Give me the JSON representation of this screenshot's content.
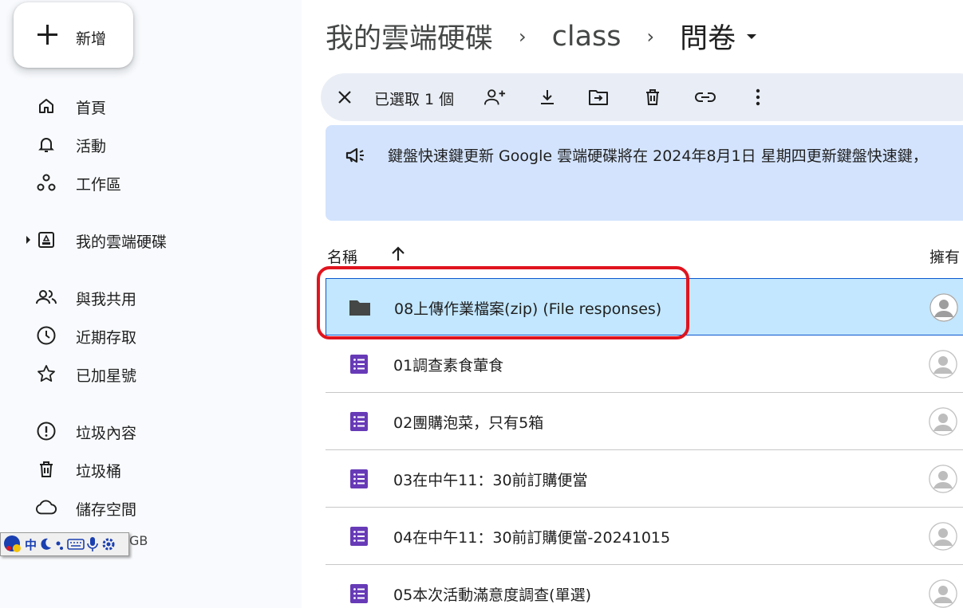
{
  "sidebar": {
    "new_label": "新增",
    "items": [
      {
        "label": "首頁",
        "icon": "home-icon"
      },
      {
        "label": "活動",
        "icon": "bell-icon"
      },
      {
        "label": "工作區",
        "icon": "workspaces-icon"
      },
      {
        "label": "我的雲端硬碟",
        "icon": "drive-icon"
      },
      {
        "label": "與我共用",
        "icon": "people-icon"
      },
      {
        "label": "近期存取",
        "icon": "clock-icon"
      },
      {
        "label": "已加星號",
        "icon": "star-icon"
      },
      {
        "label": "垃圾內容",
        "icon": "spam-icon"
      },
      {
        "label": "垃圾桶",
        "icon": "trash-icon"
      },
      {
        "label": "儲存空間",
        "icon": "cloud-icon"
      }
    ],
    "storage_fragment": "GB"
  },
  "ime": {
    "mode": "中",
    "icons": [
      "ime-logo-icon",
      "moon-icon",
      "punctuation-icon",
      "keyboard-icon",
      "mic-icon",
      "settings-icon"
    ]
  },
  "breadcrumb": {
    "items": [
      "我的雲端硬碟",
      "class",
      "問卷"
    ],
    "separator": "›"
  },
  "selection_bar": {
    "count_label": "已選取 1 個",
    "tools": [
      "share-icon",
      "download-icon",
      "move-icon",
      "trash-icon",
      "link-icon",
      "more-icon"
    ]
  },
  "banner": {
    "text": "鍵盤快速鍵更新 Google 雲端硬碟將在 2024年8月1日 星期四更新鍵盤快速鍵，"
  },
  "columns": {
    "name": "名稱",
    "owner": "擁有"
  },
  "files": [
    {
      "name": "08上傳作業檔案(zip) (File responses)",
      "type": "folder",
      "selected": true
    },
    {
      "name": "01調查素食葷食",
      "type": "form",
      "selected": false
    },
    {
      "name": "02團購泡菜，只有5箱",
      "type": "form",
      "selected": false
    },
    {
      "name": "03在中午11：30前訂購便當",
      "type": "form",
      "selected": false
    },
    {
      "name": "04在中午11：30前訂購便當-20241015",
      "type": "form",
      "selected": false
    },
    {
      "name": "05本次活動滿意度調查(單選)",
      "type": "form",
      "selected": false
    }
  ],
  "colors": {
    "accent": "#0b57d0",
    "selected_row": "#c2e7ff",
    "form_purple": "#673ab7",
    "banner_bg": "#d3e3fd",
    "highlight_red": "#e0141e"
  }
}
